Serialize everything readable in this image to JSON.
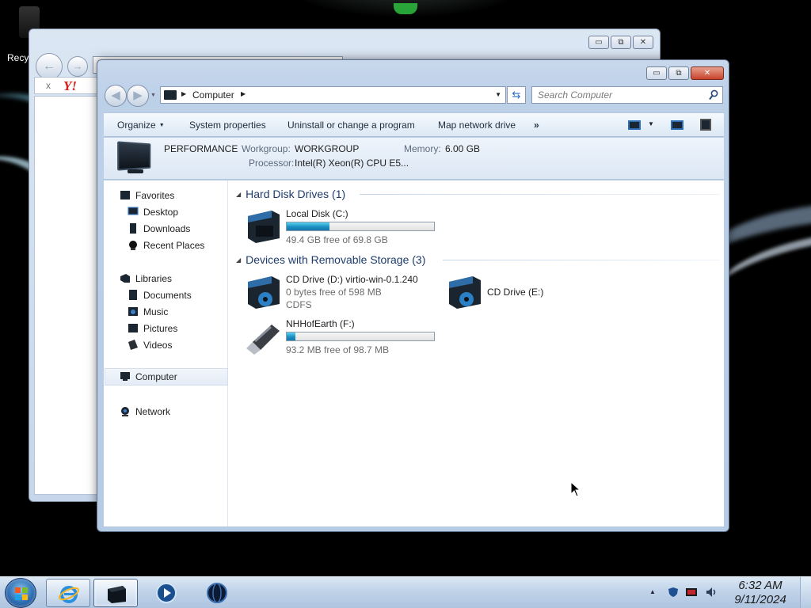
{
  "desktop": {
    "recycle_bin_label": "Recy"
  },
  "ie_window": {
    "toolbar_close": "x",
    "yahoo_logo": "Y!"
  },
  "explorer": {
    "caption_buttons": {
      "minimize": "▭",
      "maximize": "⧉",
      "close": "✕"
    },
    "address": {
      "crumb": "Computer"
    },
    "search": {
      "placeholder": "Search Computer"
    },
    "commands": {
      "organize": "Organize",
      "system_properties": "System properties",
      "uninstall": "Uninstall or change a program",
      "map_drive": "Map network drive",
      "more": "»"
    },
    "details": {
      "computer_name": "PERFORMANCE",
      "workgroup_label": "Workgroup:",
      "workgroup_value": "WORKGROUP",
      "memory_label": "Memory:",
      "memory_value": "6.00 GB",
      "processor_label": "Processor:",
      "processor_value": "Intel(R) Xeon(R) CPU E5..."
    },
    "nav": {
      "favorites": "Favorites",
      "desktop": "Desktop",
      "downloads": "Downloads",
      "recent_places": "Recent Places",
      "libraries": "Libraries",
      "documents": "Documents",
      "music": "Music",
      "pictures": "Pictures",
      "videos": "Videos",
      "computer": "Computer",
      "network": "Network"
    },
    "groups": {
      "hard_disk": "Hard Disk Drives (1)",
      "removable": "Devices with Removable Storage (3)"
    },
    "drives": {
      "c": {
        "name": "Local Disk (C:)",
        "free": "49.4 GB free of 69.8 GB",
        "used_fraction": 0.29
      },
      "d": {
        "name": "CD Drive (D:) virtio-win-0.1.240",
        "free": "0 bytes free of 598 MB",
        "fs": "CDFS"
      },
      "e": {
        "name": "CD Drive (E:)"
      },
      "f": {
        "name": "NHHofEarth (F:)",
        "free": "93.2 MB free of 98.7 MB",
        "used_fraction": 0.06
      }
    }
  },
  "taskbar": {
    "clock_time": "6:32 AM",
    "clock_date": "9/11/2024",
    "tray_expand": "▲"
  },
  "colors": {
    "accent_bar": "#1b8fc2",
    "group_header": "#1e3b6b",
    "close_button": "#c7432b"
  }
}
